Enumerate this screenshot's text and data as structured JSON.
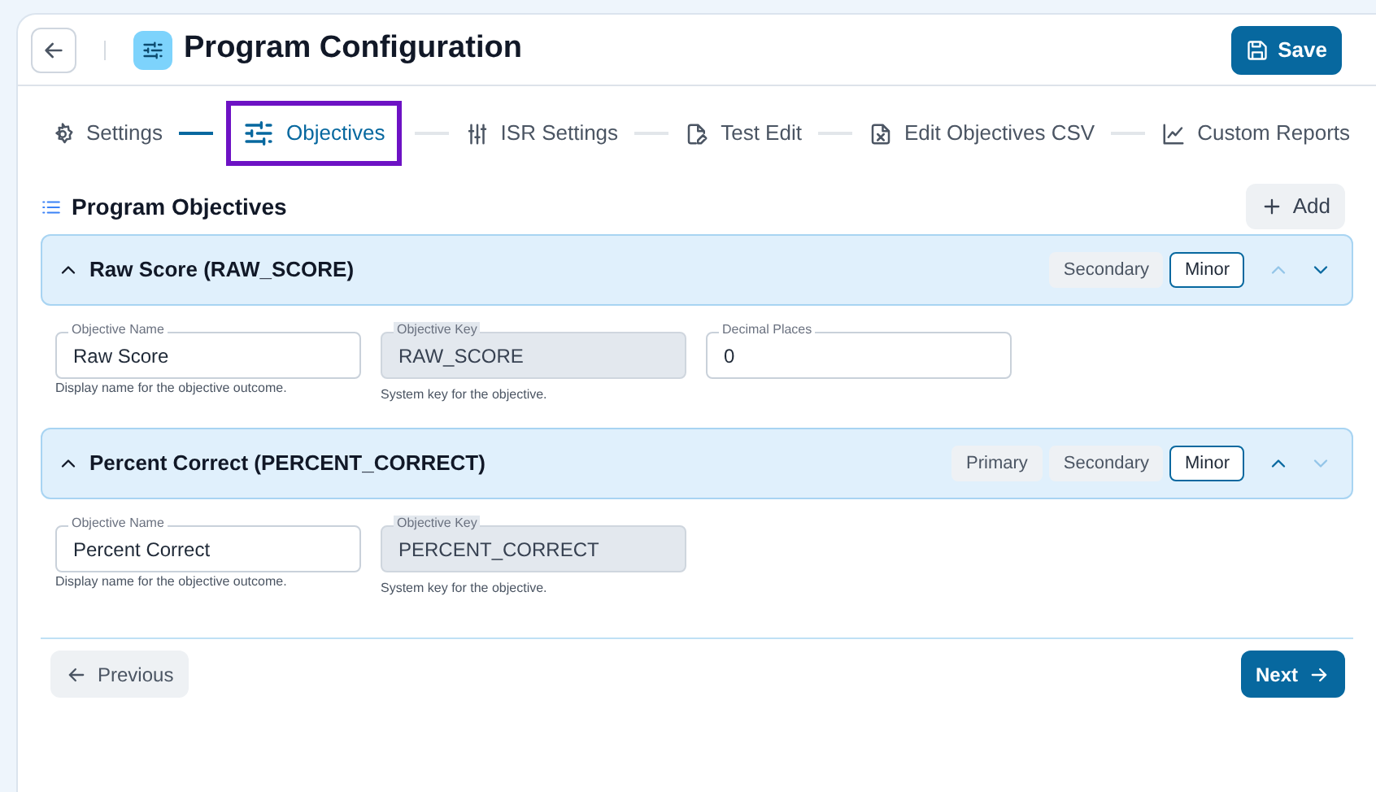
{
  "header": {
    "title": "Program Configuration",
    "save_button": "Save"
  },
  "steps": [
    {
      "label": "Settings",
      "selected": false
    },
    {
      "label": "Objectives",
      "selected": true
    },
    {
      "label": "ISR Settings",
      "selected": false
    },
    {
      "label": "Test Edit",
      "selected": false
    },
    {
      "label": "Edit Objectives CSV",
      "selected": false
    },
    {
      "label": "Custom Reports",
      "selected": false
    }
  ],
  "section": {
    "title": "Program Objectives",
    "add_button": "Add"
  },
  "objectives": [
    {
      "title": "Raw Score (RAW_SCORE)",
      "expanded": true,
      "badges": [
        {
          "label": "Secondary",
          "selected": false
        },
        {
          "label": "Minor",
          "selected": true
        }
      ],
      "move_up_disabled": true,
      "move_down_disabled": false,
      "fields": [
        {
          "label": "Objective Name",
          "value": "Raw Score",
          "help": "Display name for the objective outcome.",
          "disabled": false
        },
        {
          "label": "Objective Key",
          "value": "RAW_SCORE",
          "help": "System key for the objective.",
          "disabled": true
        },
        {
          "label": "Decimal Places",
          "value": "0",
          "disabled": false
        }
      ]
    },
    {
      "title": "Percent Correct (PERCENT_CORRECT)",
      "expanded": true,
      "badges": [
        {
          "label": "Primary",
          "selected": false
        },
        {
          "label": "Secondary",
          "selected": false
        },
        {
          "label": "Minor",
          "selected": true
        }
      ],
      "move_up_disabled": false,
      "move_down_disabled": true,
      "fields": [
        {
          "label": "Objective Name",
          "value": "Percent Correct",
          "help": "Display name for the objective outcome.",
          "disabled": false
        },
        {
          "label": "Objective Key",
          "value": "PERCENT_CORRECT",
          "help": "System key for the objective.",
          "disabled": true
        }
      ]
    }
  ],
  "footer": {
    "previous": "Previous",
    "next": "Next"
  }
}
